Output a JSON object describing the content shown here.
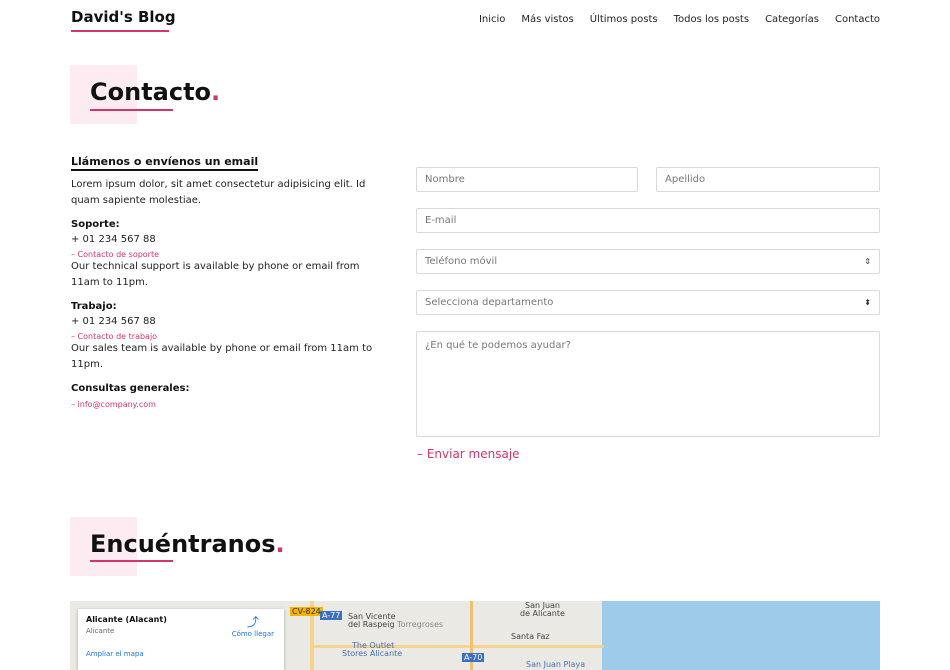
{
  "header": {
    "brand": "David's Blog",
    "nav": [
      "Inicio",
      "Más vistos",
      "Últimos posts",
      "Todos los posts",
      "Categorías",
      "Contacto"
    ]
  },
  "contact": {
    "title": "Contacto",
    "dot": ".",
    "subtitle": "Llámenos o envíenos un email",
    "intro": "Lorem ipsum dolor, sit amet consectetur adipisicing elit. Id quam sapiente molestiae.",
    "support": {
      "label": "Soporte:",
      "phone": "+ 01 234 567 88",
      "link": "– Contacto de soporte",
      "text": "Our technical support is available by phone or email from 11am to 11pm."
    },
    "work": {
      "label": "Trabajo:",
      "phone": "+ 01 234 567 88",
      "link": "– Contacto de trabajo",
      "text": "Our sales team is available by phone or email from 11am to 11pm."
    },
    "general": {
      "label": "Consultas generales:",
      "link": "– info@company.com"
    }
  },
  "form": {
    "first_name": "Nombre",
    "last_name": "Apellido",
    "email": "E-mail",
    "phone": "Teléfono móvil",
    "department": "Selecciona departamento",
    "message": "¿En qué te podemos ayudar?",
    "send": "– Enviar mensaje"
  },
  "find": {
    "title": "Encuéntranos",
    "dot": "."
  },
  "map": {
    "card_title": "Alicante (Alacant)",
    "card_subtitle": "Alicante",
    "enlarge": "Ampliar el mapa",
    "directions": "Cómo llegar",
    "labels": {
      "san_vicente": "San Vicente",
      "raspeig": "del Raspeig",
      "torregroses": "Torregroses",
      "san_juan": "San Juan",
      "de_alicante": "de Alicante",
      "santa_faz": "Santa Faz",
      "outlet": "The Outlet",
      "stores": "Stores Alicante",
      "san_juan_playa": "San Juan Playa",
      "cv824": "CV-824",
      "a77": "A-77",
      "a70": "A-70"
    }
  },
  "colors": {
    "accent": "#d6336c",
    "accent_light": "#fcecf2",
    "sea": "#9ecbea"
  }
}
